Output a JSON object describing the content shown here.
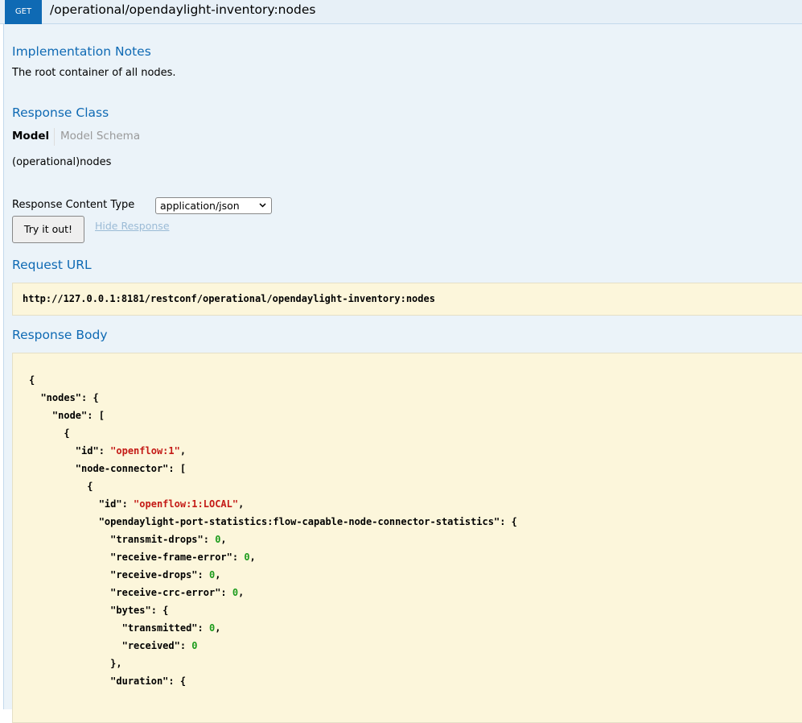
{
  "operation": {
    "method": "GET",
    "path": "/operational/opendaylight-inventory:nodes"
  },
  "implementation_notes": {
    "heading": "Implementation Notes",
    "text": "The root container of all nodes."
  },
  "response_class": {
    "heading": "Response Class",
    "tab_model": "Model",
    "tab_schema": "Model Schema",
    "model_name": "(operational)nodes"
  },
  "content_type": {
    "label": "Response Content Type",
    "selected": "application/json"
  },
  "actions": {
    "try_label": "Try it out!",
    "hide_label": "Hide Response"
  },
  "request_url": {
    "heading": "Request URL",
    "value": "http://127.0.0.1:8181/restconf/operational/opendaylight-inventory:nodes"
  },
  "response_body": {
    "heading": "Response Body",
    "lines": [
      [
        {
          "t": "{",
          "c": "p"
        }
      ],
      [
        {
          "t": "  \"nodes\": {",
          "c": "p"
        }
      ],
      [
        {
          "t": "    \"node\": [",
          "c": "p"
        }
      ],
      [
        {
          "t": "      {",
          "c": "p"
        }
      ],
      [
        {
          "t": "        \"id\": ",
          "c": "p"
        },
        {
          "t": "\"openflow:1\"",
          "c": "s"
        },
        {
          "t": ",",
          "c": "p"
        }
      ],
      [
        {
          "t": "        \"node-connector\": [",
          "c": "p"
        }
      ],
      [
        {
          "t": "          {",
          "c": "p"
        }
      ],
      [
        {
          "t": "            \"id\": ",
          "c": "p"
        },
        {
          "t": "\"openflow:1:LOCAL\"",
          "c": "s"
        },
        {
          "t": ",",
          "c": "p"
        }
      ],
      [
        {
          "t": "            \"opendaylight-port-statistics:flow-capable-node-connector-statistics\": {",
          "c": "p"
        }
      ],
      [
        {
          "t": "              \"transmit-drops\": ",
          "c": "p"
        },
        {
          "t": "0",
          "c": "n"
        },
        {
          "t": ",",
          "c": "p"
        }
      ],
      [
        {
          "t": "              \"receive-frame-error\": ",
          "c": "p"
        },
        {
          "t": "0",
          "c": "n"
        },
        {
          "t": ",",
          "c": "p"
        }
      ],
      [
        {
          "t": "              \"receive-drops\": ",
          "c": "p"
        },
        {
          "t": "0",
          "c": "n"
        },
        {
          "t": ",",
          "c": "p"
        }
      ],
      [
        {
          "t": "              \"receive-crc-error\": ",
          "c": "p"
        },
        {
          "t": "0",
          "c": "n"
        },
        {
          "t": ",",
          "c": "p"
        }
      ],
      [
        {
          "t": "              \"bytes\": {",
          "c": "p"
        }
      ],
      [
        {
          "t": "                \"transmitted\": ",
          "c": "p"
        },
        {
          "t": "0",
          "c": "n"
        },
        {
          "t": ",",
          "c": "p"
        }
      ],
      [
        {
          "t": "                \"received\": ",
          "c": "p"
        },
        {
          "t": "0",
          "c": "n"
        }
      ],
      [
        {
          "t": "              },",
          "c": "p"
        }
      ],
      [
        {
          "t": "              \"duration\": {",
          "c": "p"
        }
      ]
    ]
  },
  "colors": {
    "accent": "#0f6ab4",
    "string": "#c41a16",
    "number": "#1c9b1c",
    "code_background": "#fcf6db"
  }
}
